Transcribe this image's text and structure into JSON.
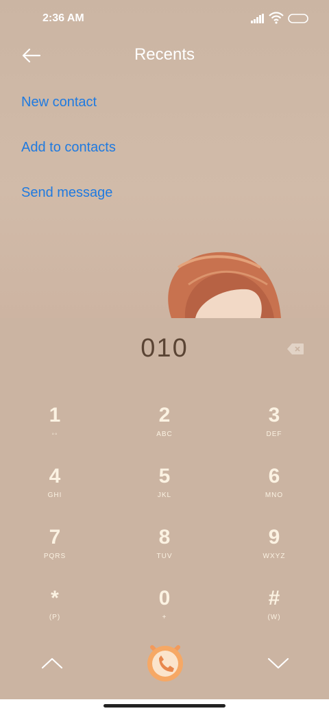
{
  "status_bar": {
    "time": "2:36 AM"
  },
  "header": {
    "title": "Recents"
  },
  "actions": {
    "new_contact": "New contact",
    "add_to_contacts": "Add to contacts",
    "send_message": "Send message"
  },
  "dialer": {
    "number": "010",
    "keys": [
      {
        "digit": "1",
        "sub": "◦◦"
      },
      {
        "digit": "2",
        "sub": "ABC"
      },
      {
        "digit": "3",
        "sub": "DEF"
      },
      {
        "digit": "4",
        "sub": "GHI"
      },
      {
        "digit": "5",
        "sub": "JKL"
      },
      {
        "digit": "6",
        "sub": "MNO"
      },
      {
        "digit": "7",
        "sub": "PQRS"
      },
      {
        "digit": "8",
        "sub": "TUV"
      },
      {
        "digit": "9",
        "sub": "WXYZ"
      },
      {
        "digit": "*",
        "sub": "(P)"
      },
      {
        "digit": "0",
        "sub": "+"
      },
      {
        "digit": "#",
        "sub": "(W)"
      }
    ]
  },
  "colors": {
    "accent": "#1f7ae0",
    "background": "#cdb6a4",
    "key_text": "#fbf2e2",
    "call": "#f0a060"
  },
  "icons": {
    "back": "arrow-left-icon",
    "delete": "backspace-icon",
    "up": "chevron-up-icon",
    "down": "chevron-down-icon",
    "call": "phone-icon"
  }
}
